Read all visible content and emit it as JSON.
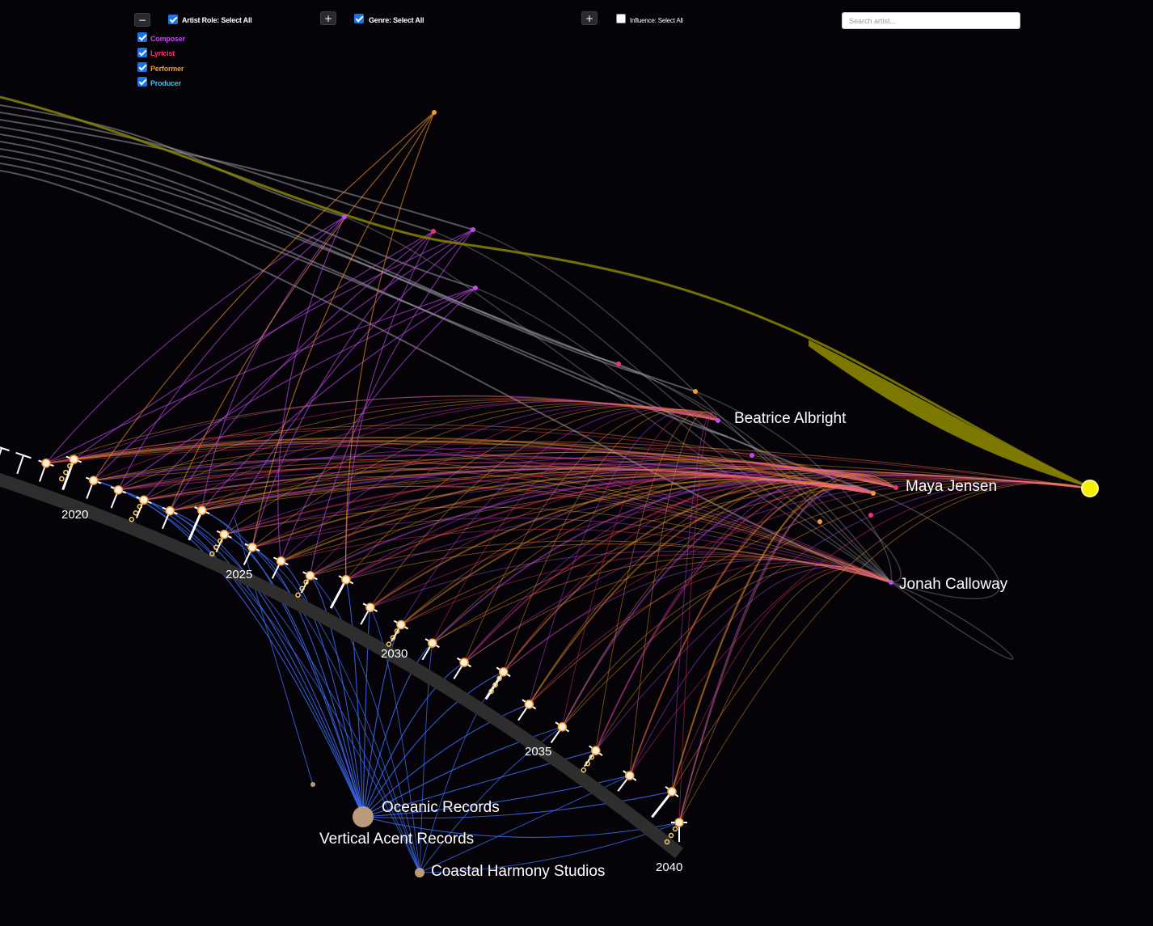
{
  "controls": {
    "collapse_label": "−",
    "expand_label_1": "+",
    "expand_label_2": "+",
    "artist_role": {
      "select_all_label": "Artist Role: Select All",
      "select_all_checked": true,
      "options": [
        {
          "label": "Composer",
          "color": "#c24bf0",
          "checked": true
        },
        {
          "label": "Lyricist",
          "color": "#f0336e",
          "checked": true
        },
        {
          "label": "Performer",
          "color": "#f59a2e",
          "checked": true
        },
        {
          "label": "Producer",
          "color": "#33c4f0",
          "checked": true
        }
      ]
    },
    "genre": {
      "select_all_label": "Genre: Select All",
      "select_all_checked": true
    },
    "influence": {
      "select_all_label": "Influence: Select All",
      "select_all_checked": false
    },
    "search": {
      "placeholder": "Search artist..."
    }
  },
  "timeline": {
    "year_labels": [
      "2020",
      "2025",
      "2030",
      "2035",
      "2040"
    ]
  },
  "artists": {
    "beatrice": "Beatrice Albright",
    "maya": "Maya Jensen",
    "jonah": "Jonah Calloway"
  },
  "labels": {
    "oceanic": "Oceanic Records",
    "vertical": "Vertical Acent Records",
    "coastal": "Coastal Harmony Studios"
  },
  "colors": {
    "composer": "#c24bf0",
    "lyricist": "#f0336e",
    "performer": "#f59a2e",
    "producer": "#33c4f0",
    "record_label_link": "#3b6cf0",
    "highlight_path": "#8a8500",
    "focus_node": "#f5f000",
    "axis": "#2e2e2e"
  }
}
